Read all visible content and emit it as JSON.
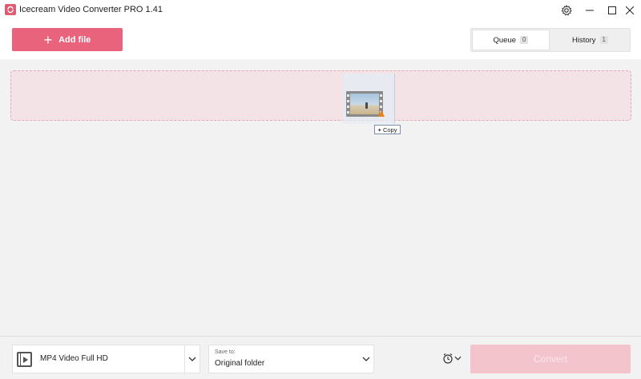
{
  "window": {
    "title": "Icecream Video Converter PRO 1.41",
    "app_icon": "icecream-logo-icon",
    "controls": [
      "gear-icon",
      "minimize-icon",
      "maximize-icon",
      "close-icon"
    ]
  },
  "header": {
    "add_file_label": "Add file",
    "tabs": [
      {
        "label": "Queue",
        "count": "0",
        "active": true
      },
      {
        "label": "History",
        "count": "1",
        "active": false
      }
    ]
  },
  "drag": {
    "tooltip_label": "Copy",
    "thumbnail_icon": "video-file-icon"
  },
  "footer": {
    "format_value": "MP4 Video Full HD",
    "format_icon": "video-format-icon",
    "save_caption": "Save to:",
    "save_value": "Original folder",
    "schedule_icon": "alarm-clock-icon",
    "convert_label": "Convert"
  },
  "colors": {
    "accent": "#e8637b",
    "dropzone_bg": "#f3e3e6",
    "convert_disabled": "#f4c4cd"
  }
}
